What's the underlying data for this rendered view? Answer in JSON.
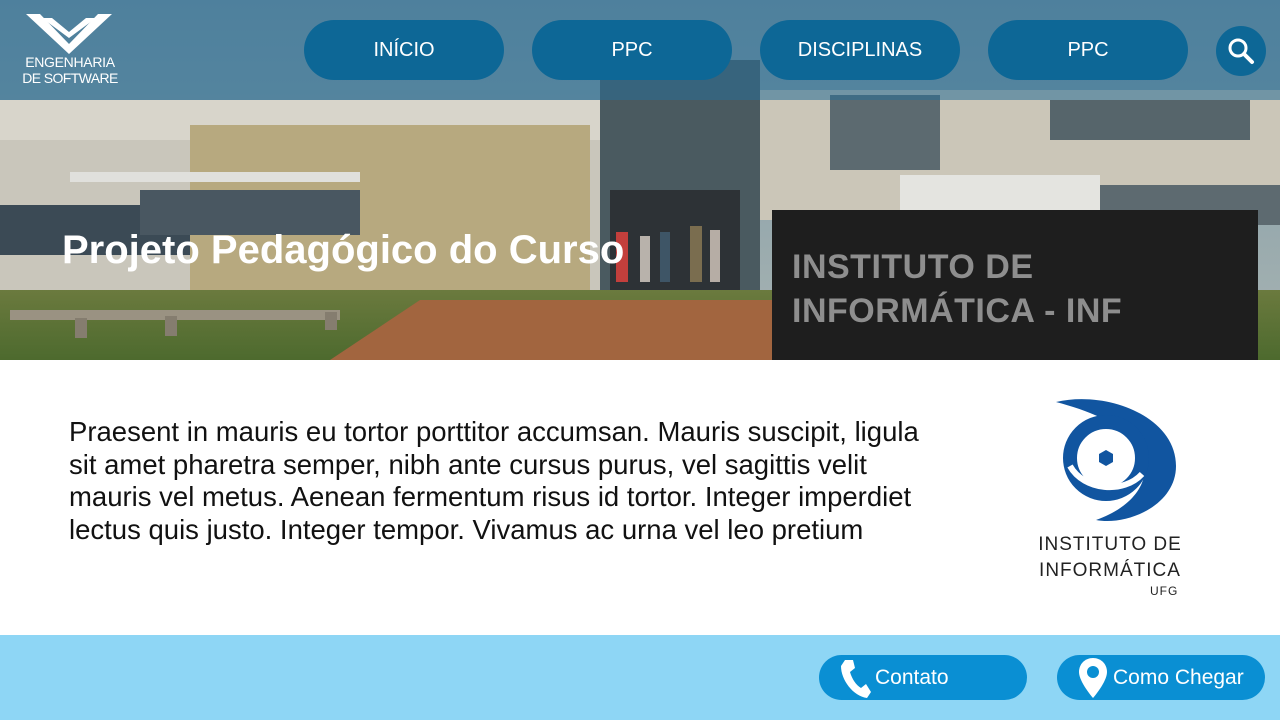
{
  "brand": {
    "line1": "ENGENHARIA",
    "line2": "DE SOFTWARE"
  },
  "nav": {
    "items": [
      {
        "label": "INÍCIO"
      },
      {
        "label": "PPC"
      },
      {
        "label": "DISCIPLINAS"
      },
      {
        "label": "PPC"
      }
    ],
    "search_icon": "search-icon"
  },
  "hero": {
    "title": "Projeto Pedagógico do Curso",
    "sign_line1": "INSTITUTO DE",
    "sign_line2": "INFORMÁTICA - INF"
  },
  "content": {
    "paragraph": "Praesent in mauris eu tortor porttitor accumsan. Mauris suscipit, ligula sit amet pharetra semper, nibh ante cursus purus, vel sagittis velit mauris vel metus. Aenean fermentum risus id tortor. Integer imperdiet lectus quis justo. Integer tempor. Vivamus ac urna vel leo pretium"
  },
  "institute_logo": {
    "line1": "INSTITUTO DE",
    "line2": "INFORMÁTICA",
    "line3": "UFG"
  },
  "footer": {
    "contact_label": "Contato",
    "contact_icon": "phone-icon",
    "directions_label": "Como Chegar",
    "directions_icon": "map-pin-icon"
  },
  "colors": {
    "nav_button": "#0d6796",
    "footer_bg": "#8ed6f5",
    "footer_button": "#0a8fd3",
    "logo_blue": "#1155a0"
  }
}
